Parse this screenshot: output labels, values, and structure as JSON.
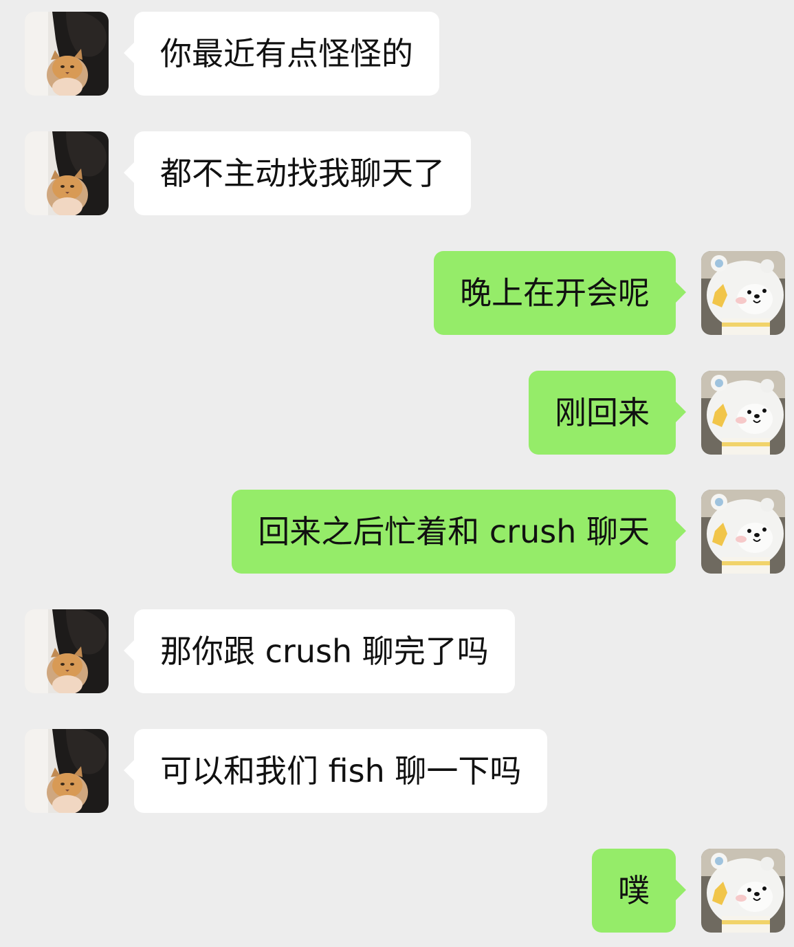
{
  "chat": {
    "background_color": "#ededed",
    "incoming_bubble_color": "#ffffff",
    "outgoing_bubble_color": "#95ec69",
    "contact_avatar": "photo-person-hugging-cat",
    "self_avatar": "plush-bear-photo",
    "messages": [
      {
        "side": "left",
        "text": "你最近有点怪怪的"
      },
      {
        "side": "left",
        "text": "都不主动找我聊天了"
      },
      {
        "side": "right",
        "text": "晚上在开会呢"
      },
      {
        "side": "right",
        "text": "刚回来"
      },
      {
        "side": "right",
        "text": "回来之后忙着和 crush 聊天"
      },
      {
        "side": "left",
        "text": "那你跟 crush 聊完了吗"
      },
      {
        "side": "left",
        "text": "可以和我们 fish 聊一下吗"
      },
      {
        "side": "right",
        "text": "噗"
      }
    ]
  }
}
